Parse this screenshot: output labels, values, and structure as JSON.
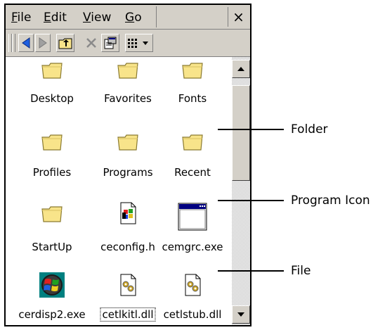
{
  "menu": {
    "items": [
      {
        "label": "File"
      },
      {
        "label": "Edit"
      },
      {
        "label": "View"
      },
      {
        "label": "Go"
      }
    ],
    "close_label": "×"
  },
  "files": [
    {
      "label": "Desktop",
      "icon": "folder-icon"
    },
    {
      "label": "Favorites",
      "icon": "folder-icon"
    },
    {
      "label": "Fonts",
      "icon": "folder-icon"
    },
    {
      "label": "Profiles",
      "icon": "folder-icon"
    },
    {
      "label": "Programs",
      "icon": "folder-icon"
    },
    {
      "label": "Recent",
      "icon": "folder-icon"
    },
    {
      "label": "StartUp",
      "icon": "folder-icon"
    },
    {
      "label": "ceconfig.h",
      "icon": "header-file-icon"
    },
    {
      "label": "cemgrc.exe",
      "icon": "program-window-icon"
    },
    {
      "label": "cerdisp2.exe",
      "icon": "windows-logo-icon"
    },
    {
      "label": "cetlkitl.dll",
      "icon": "dll-file-icon",
      "selected": true
    },
    {
      "label": "cetlstub.dll",
      "icon": "dll-file-icon"
    }
  ],
  "callouts": [
    {
      "label": "Folder"
    },
    {
      "label": "Program Icon"
    },
    {
      "label": "File"
    }
  ],
  "colors": {
    "chrome": "#d4d0c8",
    "folder": "#f8e48a",
    "arrow_blue": "#1e5fe0"
  }
}
